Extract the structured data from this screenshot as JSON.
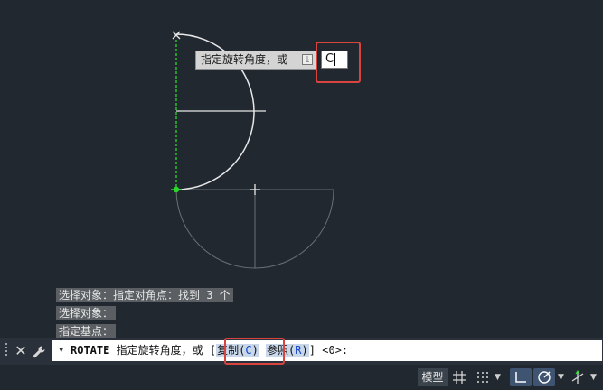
{
  "tooltip": {
    "prompt": "指定旋转角度，或",
    "icon": "download-icon"
  },
  "dynamic_input": {
    "value": "C"
  },
  "history": [
    "选择对象：指定对角点：找到 3 个",
    "选择对象：",
    "指定基点："
  ],
  "command_line": {
    "command": "ROTATE",
    "prompt": "指定旋转角度，或",
    "bracket_open": "[",
    "option1": {
      "label": "复制",
      "key": "C"
    },
    "option2": {
      "label": "参照",
      "key": "R"
    },
    "bracket_close": "]",
    "default": "<0>:"
  },
  "command_icons": {
    "close": "close-icon",
    "customize": "wrench-icon"
  },
  "status_bar": {
    "model_label": "模型",
    "icons": [
      "grid-icon",
      "snap-icon",
      "ortho-icon",
      "polar-icon",
      "isodraft-icon"
    ]
  },
  "colors": {
    "background": "#212830",
    "highlight": "#d9453e",
    "arc": "#e8e8e8",
    "ghost_arc": "#6b6f73",
    "axis": "#2bd62b"
  }
}
